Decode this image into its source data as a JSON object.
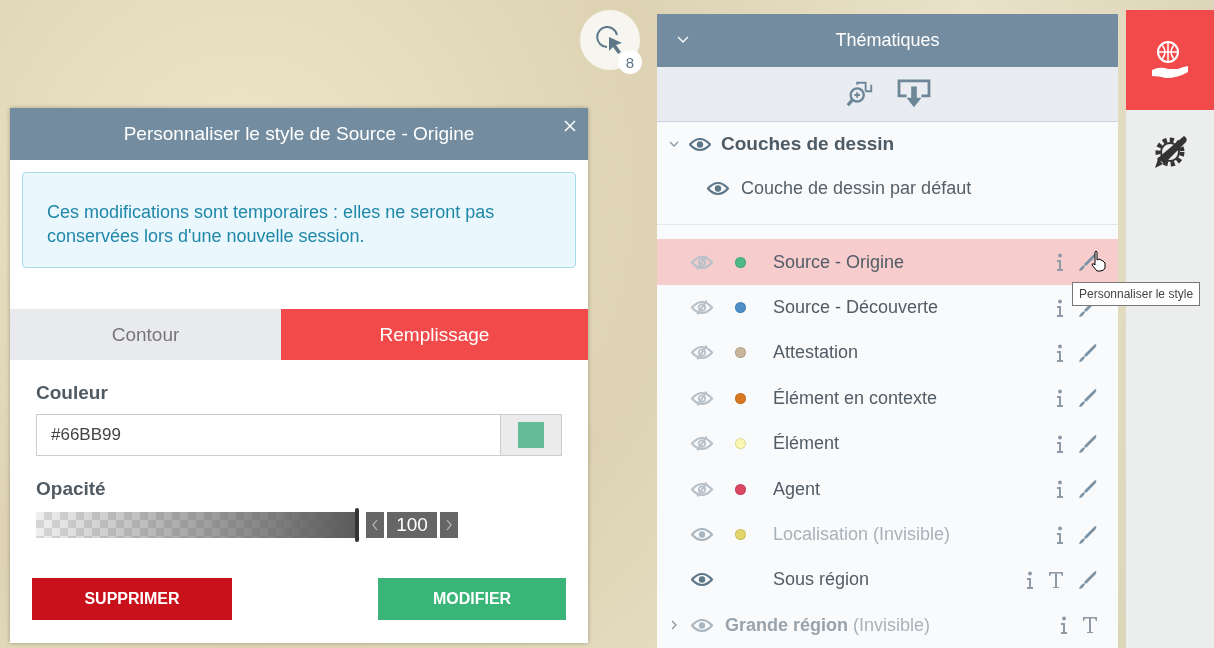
{
  "selection_badge": {
    "count": "8"
  },
  "dialog": {
    "title": "Personnaliser le style de Source - Origine",
    "notice": "Ces modifications sont temporaires : elles ne seront pas conservées lors d'une nouvelle session.",
    "tabs": [
      {
        "label": "Contour",
        "selected": false
      },
      {
        "label": "Remplissage",
        "selected": true
      }
    ],
    "color": {
      "label": "Couleur",
      "value": "#66BB99"
    },
    "opacity": {
      "label": "Opacité",
      "level": 1,
      "value": "100"
    },
    "buttons": [
      {
        "label": "SUPPRIMER",
        "kind": "danger"
      },
      {
        "label": "MODIFIER",
        "kind": "confirm"
      }
    ]
  },
  "panel": {
    "title": "Thématiques",
    "groups": [
      {
        "name": "Couches de dessin",
        "expanded": true,
        "visible": true,
        "children": [
          {
            "name": "Couche de dessin par défaut",
            "visible": true
          }
        ]
      }
    ],
    "layers": [
      {
        "kind": "layer",
        "name": "Source - Origine",
        "color": "#4dbb88",
        "visible": false,
        "dimmed": false,
        "selected": true,
        "actions": [
          {
            "kind": "info"
          },
          {
            "kind": "style"
          }
        ]
      },
      {
        "kind": "layer",
        "name": "Source - Découverte",
        "color": "#4d8fc7",
        "visible": false,
        "dimmed": false,
        "selected": false,
        "actions": [
          {
            "kind": "info"
          },
          {
            "kind": "style"
          }
        ]
      },
      {
        "kind": "layer",
        "name": "Attestation",
        "color": "#c9b59c",
        "visible": false,
        "dimmed": false,
        "selected": false,
        "actions": [
          {
            "kind": "info"
          },
          {
            "kind": "style"
          }
        ]
      },
      {
        "kind": "layer",
        "name": "Élément en contexte",
        "color": "#d9781e",
        "visible": false,
        "dimmed": false,
        "selected": false,
        "actions": [
          {
            "kind": "info"
          },
          {
            "kind": "style"
          }
        ]
      },
      {
        "kind": "layer",
        "name": "Élément",
        "color": "#fbf7b3",
        "visible": false,
        "dimmed": false,
        "selected": false,
        "actions": [
          {
            "kind": "info"
          },
          {
            "kind": "style"
          }
        ]
      },
      {
        "kind": "layer",
        "name": "Agent",
        "color": "#dc4660",
        "visible": false,
        "dimmed": false,
        "selected": false,
        "actions": [
          {
            "kind": "info"
          },
          {
            "kind": "style"
          }
        ]
      },
      {
        "kind": "layer",
        "name": "Localisation (Invisible)",
        "color": "#e3d66a",
        "visible": true,
        "dimmed": true,
        "selected": false,
        "actions": [
          {
            "kind": "info"
          },
          {
            "kind": "style"
          }
        ]
      },
      {
        "kind": "layer",
        "name": "Sous région",
        "visible": true,
        "dimmed": false,
        "selected": false,
        "actions": [
          {
            "kind": "info"
          },
          {
            "kind": "text"
          },
          {
            "kind": "style"
          }
        ]
      },
      {
        "kind": "group",
        "name": "**Grande région** (Invisible)",
        "expanded": false,
        "visible": true,
        "dimmed": true,
        "selected": false,
        "actions": [
          {
            "kind": "info"
          },
          {
            "kind": "text"
          }
        ]
      }
    ]
  },
  "tooltip": {
    "text": "Personnaliser le style"
  }
}
